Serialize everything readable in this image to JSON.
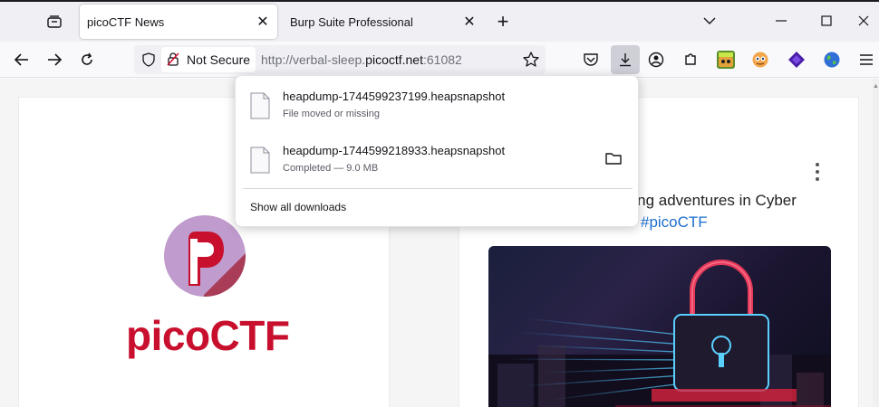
{
  "tabs": [
    {
      "label": "picoCTF News",
      "active": true
    },
    {
      "label": "Burp Suite Professional",
      "active": false
    }
  ],
  "navbar": {
    "security_label": "Not Secure",
    "url_prefix": "http://verbal-sleep.",
    "url_host": "picoctf.net",
    "url_suffix": ":61082"
  },
  "downloads": {
    "items": [
      {
        "name": "heapdump-1744599237199.heapsnapshot",
        "status": "File moved or missing"
      },
      {
        "name": "heapdump-1744599218933.heapsnapshot",
        "status": "Completed — 9.0 MB"
      }
    ],
    "show_all_label": "Show all downloads"
  },
  "page": {
    "logo_text": "picoCTF",
    "post_line1": "ploring adventures in Cyber",
    "post_line2": "#picoCTF"
  },
  "colors": {
    "brand_red": "#c8102e",
    "brand_purple": "#c09bcd",
    "link_blue": "#1d6fce"
  }
}
